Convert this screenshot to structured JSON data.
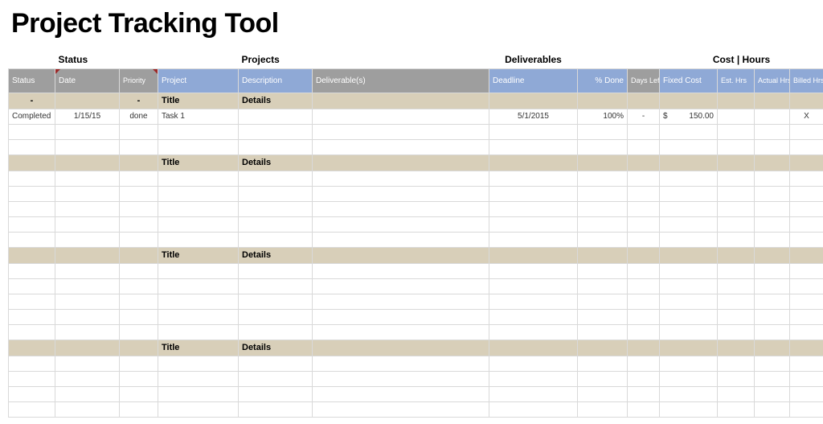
{
  "title": "Project Tracking Tool",
  "groups": {
    "status": "Status",
    "projects": "Projects",
    "deliverables": "Deliverables",
    "costhours": "Cost | Hours"
  },
  "columns": {
    "status": "Status",
    "date": "Date",
    "priority": "Priority",
    "project": "Project",
    "description": "Description",
    "deliverables": "Deliverable(s)",
    "deadline": "Deadline",
    "pdone": "% Done",
    "days_left": "Days Left",
    "fixed_cost": "Fixed Cost",
    "est_hrs": "Est. Hrs",
    "actual_hrs": "Actual Hrs",
    "billed_hrs": "Billed Hrs"
  },
  "section_labels": {
    "title": "Title",
    "details": "Details"
  },
  "sections": [
    {
      "status_dash": "-",
      "priority_dash": "-",
      "rows": [
        {
          "status": "Completed",
          "date": "1/15/15",
          "priority": "done",
          "project": "Task 1",
          "description": "",
          "deliverables": "",
          "deadline": "5/1/2015",
          "pdone": "100%",
          "days_left": "-",
          "fixed_cost_sym": "$",
          "fixed_cost_val": "150.00",
          "est_hrs": "",
          "actual_hrs": "",
          "billed_hrs": "X"
        },
        null,
        null
      ]
    },
    {
      "rows": [
        null,
        null,
        null,
        null,
        null
      ]
    },
    {
      "rows": [
        null,
        null,
        null,
        null,
        null
      ]
    },
    {
      "rows": [
        null,
        null,
        null,
        null
      ]
    }
  ]
}
